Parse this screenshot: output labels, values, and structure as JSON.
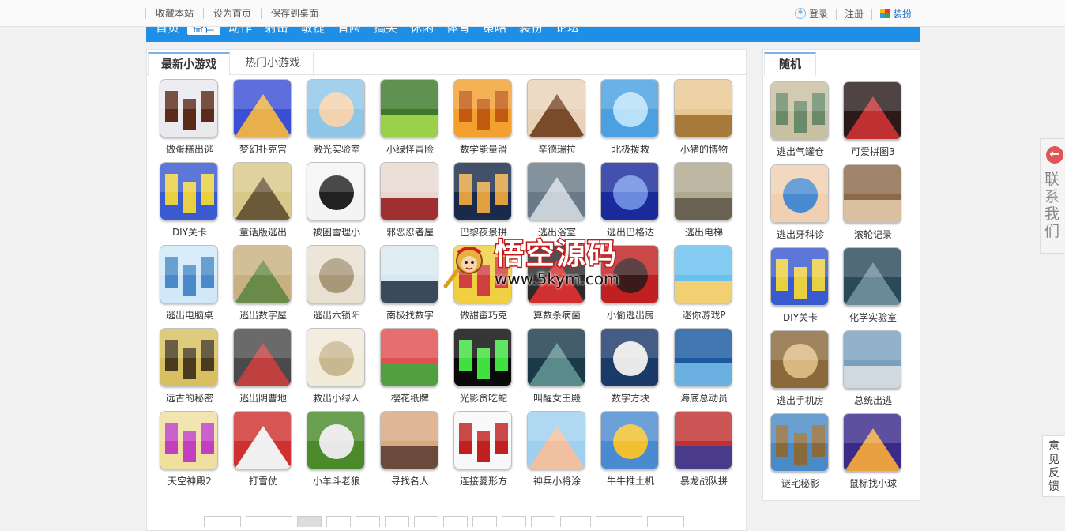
{
  "topbar": {
    "links": [
      "收藏本站",
      "设为首页",
      "保存到桌面"
    ],
    "login": "登录",
    "register": "注册",
    "skin": "装扮"
  },
  "nav": {
    "items": [
      "首页",
      "益智",
      "动作",
      "射击",
      "敏捷",
      "冒险",
      "搞笑",
      "休闲",
      "体育",
      "策略",
      "装扮",
      "论坛"
    ],
    "active_index": 1
  },
  "main": {
    "tabs": [
      "最新小游戏",
      "热门小游戏"
    ],
    "games": [
      {
        "title": "做蛋糕出逃",
        "c1": "#e9e9ee",
        "c2": "#5a2a1a"
      },
      {
        "title": "梦幻扑克宫",
        "c1": "#3b4fd6",
        "c2": "#e8b04a"
      },
      {
        "title": "激光实验室",
        "c1": "#8fc6e8",
        "c2": "#f3d2b0"
      },
      {
        "title": "小绿怪冒险",
        "c1": "#3c7a2a",
        "c2": "#9ad04a"
      },
      {
        "title": "数学能量滑",
        "c1": "#f2a030",
        "c2": "#c25a10"
      },
      {
        "title": "辛德瑞拉",
        "c1": "#e8d2b8",
        "c2": "#7a4a2a"
      },
      {
        "title": "北极援救",
        "c1": "#4aa0e0",
        "c2": "#b8e0f8"
      },
      {
        "title": "小猪的博物",
        "c1": "#e8c890",
        "c2": "#a87a3a"
      },
      {
        "title": "DIY关卡",
        "c1": "#3a5ad0",
        "c2": "#e8d040"
      },
      {
        "title": "童话版逃出",
        "c1": "#d8c88a",
        "c2": "#6a5a3a"
      },
      {
        "title": "被困雪理小",
        "c1": "#f4f4f4",
        "c2": "#222222"
      },
      {
        "title": "邪恶忍者屋",
        "c1": "#e8d8d0",
        "c2": "#a03030"
      },
      {
        "title": "巴黎夜景拼",
        "c1": "#1a2a4a",
        "c2": "#e0a040"
      },
      {
        "title": "逃出浴室",
        "c1": "#6a7a88",
        "c2": "#c8d0d8"
      },
      {
        "title": "逃出巴格达",
        "c1": "#1a2a9a",
        "c2": "#6a8ae0"
      },
      {
        "title": "逃出电梯",
        "c1": "#b0a890",
        "c2": "#6a6250"
      },
      {
        "title": "逃出电脑桌",
        "c1": "#d0e8f8",
        "c2": "#4a8ac8"
      },
      {
        "title": "逃出数字屋",
        "c1": "#c8b080",
        "c2": "#6a8a4a"
      },
      {
        "title": "逃出六锁阳",
        "c1": "#e8e0d0",
        "c2": "#a89878"
      },
      {
        "title": "南极找数字",
        "c1": "#d8e8f0",
        "c2": "#3a4a5a"
      },
      {
        "title": "做甜蜜巧克",
        "c1": "#f0d040",
        "c2": "#d04040"
      },
      {
        "title": "算数杀病菌",
        "c1": "#2a2a2a",
        "c2": "#d03030"
      },
      {
        "title": "小偷逃出房",
        "c1": "#c02020",
        "c2": "#3a1a1a"
      },
      {
        "title": "迷你游戏P",
        "c1": "#6ac0f0",
        "c2": "#f0d070"
      },
      {
        "title": "远古的秘密",
        "c1": "#d8c060",
        "c2": "#4a3a20"
      },
      {
        "title": "逃出阴曹地",
        "c1": "#4a4a4a",
        "c2": "#c04040"
      },
      {
        "title": "救出小绿人",
        "c1": "#f0ead8",
        "c2": "#c8b890"
      },
      {
        "title": "樱花纸牌",
        "c1": "#e05050",
        "c2": "#50a040"
      },
      {
        "title": "光影贪吃蛇",
        "c1": "#0a0a0a",
        "c2": "#40e040"
      },
      {
        "title": "叫醒女王殿",
        "c1": "#1a3a4a",
        "c2": "#5a8a8a"
      },
      {
        "title": "数字方块",
        "c1": "#1a3a6a",
        "c2": "#e8e8e8"
      },
      {
        "title": "海底总动员",
        "c1": "#1a5aa0",
        "c2": "#6ab0e0"
      },
      {
        "title": "天空神殿2",
        "c1": "#f0e0a0",
        "c2": "#c040c0"
      },
      {
        "title": "打雪仗",
        "c1": "#d03030",
        "c2": "#f0f0f0"
      },
      {
        "title": "小羊斗老狼",
        "c1": "#4a8a2a",
        "c2": "#e8e8e8"
      },
      {
        "title": "寻找名人",
        "c1": "#d8a880",
        "c2": "#6a4a3a"
      },
      {
        "title": "连接菱形方",
        "c1": "#f8f8f8",
        "c2": "#c02020"
      },
      {
        "title": "神兵小将涂",
        "c1": "#a0d0f0",
        "c2": "#f0c0a0"
      },
      {
        "title": "牛牛推土机",
        "c1": "#4a8ad0",
        "c2": "#f0c030"
      },
      {
        "title": "暴龙战队拼",
        "c1": "#c03030",
        "c2": "#4a3a8a"
      }
    ]
  },
  "side": {
    "tab": "随机",
    "games": [
      {
        "title": "逃出气罐仓",
        "c1": "#c8c0a0",
        "c2": "#6a8a6a"
      },
      {
        "title": "可爱拼图3",
        "c1": "#2a1a1a",
        "c2": "#c03030"
      },
      {
        "title": "逃出牙科诊",
        "c1": "#f0d0b0",
        "c2": "#4a8ad0"
      },
      {
        "title": "滚轮记录",
        "c1": "#8a6a4a",
        "c2": "#d8c0a0"
      },
      {
        "title": "DIY关卡",
        "c1": "#3a5ad0",
        "c2": "#e8d040"
      },
      {
        "title": "化学实验室",
        "c1": "#2a4a5a",
        "c2": "#6a8a9a"
      },
      {
        "title": "逃出手机房",
        "c1": "#8a6a3a",
        "c2": "#d8b880"
      },
      {
        "title": "总统出逃",
        "c1": "#7aa0c0",
        "c2": "#d0d8e0"
      },
      {
        "title": "谜宅秘影",
        "c1": "#4a8ac8",
        "c2": "#8a6a3a"
      },
      {
        "title": "鼠标找小球",
        "c1": "#3a2a8a",
        "c2": "#e8a040"
      }
    ]
  },
  "watermark": {
    "title": "悟空源码",
    "url": "www.5kym.com"
  },
  "contact": {
    "arrow": "←",
    "label": "联系我们"
  },
  "feedback": {
    "label": "意见反馈"
  }
}
